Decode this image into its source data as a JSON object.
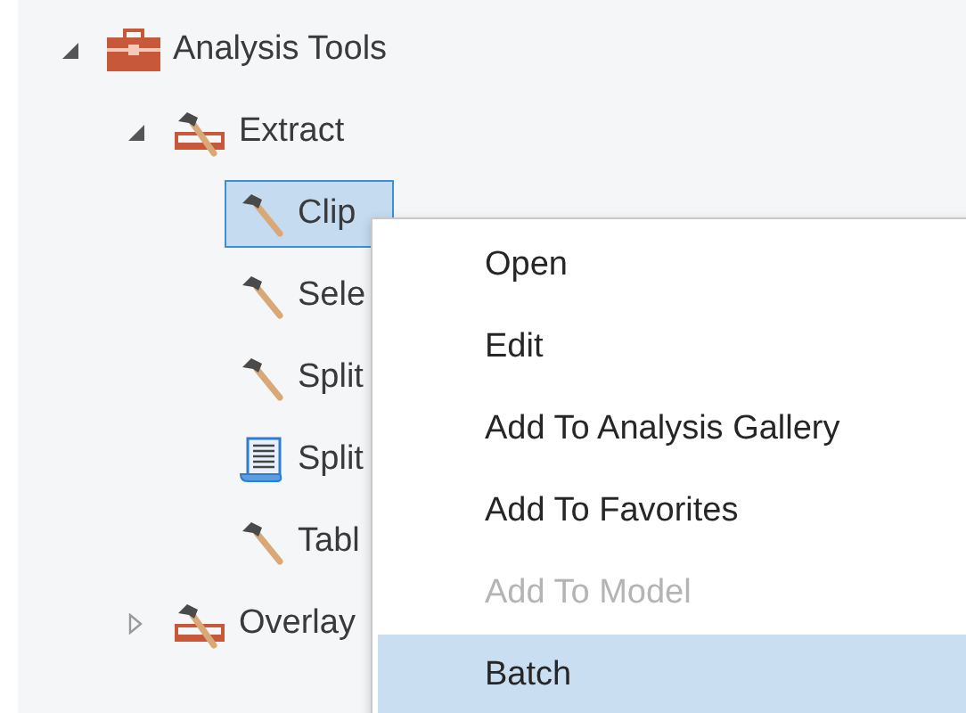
{
  "tree": [
    {
      "kind": "toolbox",
      "label": "Analysis Tools",
      "expanded": true,
      "selected": false,
      "children": [
        {
          "kind": "toolset",
          "label": "Extract",
          "expanded": true,
          "selected": false,
          "children": [
            {
              "kind": "tool",
              "label": "Clip",
              "selected": true
            },
            {
              "kind": "tool",
              "label": "Sele",
              "selected": false
            },
            {
              "kind": "tool",
              "label": "Split",
              "selected": false
            },
            {
              "kind": "script",
              "label": "Split",
              "selected": false
            },
            {
              "kind": "tool",
              "label": "Tabl",
              "selected": false
            }
          ]
        },
        {
          "kind": "toolset",
          "label": "Overlay",
          "expanded": false,
          "selected": false
        }
      ]
    }
  ],
  "context_menu": [
    {
      "label": "Open",
      "disabled": false,
      "selected": false
    },
    {
      "label": "Edit",
      "disabled": false,
      "selected": false
    },
    {
      "label": "Add To Analysis Gallery",
      "disabled": false,
      "selected": false
    },
    {
      "label": "Add To Favorites",
      "disabled": false,
      "selected": false
    },
    {
      "label": "Add To Model",
      "disabled": true,
      "selected": false
    },
    {
      "label": "Batch",
      "disabled": false,
      "selected": true
    }
  ]
}
